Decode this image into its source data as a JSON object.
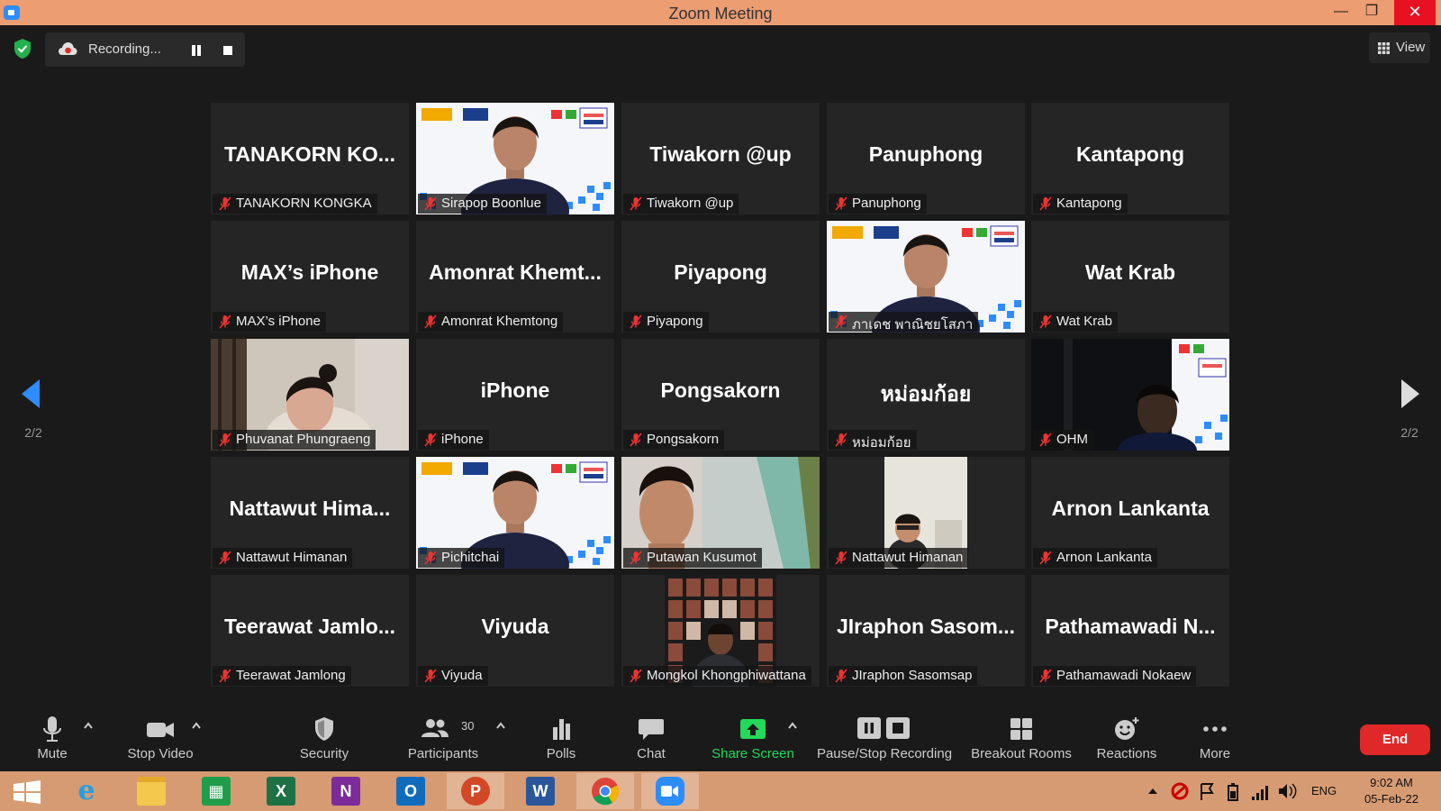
{
  "window": {
    "title": "Zoom Meeting"
  },
  "recording": {
    "label": "Recording..."
  },
  "view_label": "View",
  "pagination": {
    "left": "2/2",
    "right": "2/2"
  },
  "tiles": [
    {
      "big": "TANAKORN  KO...",
      "name": "TANAKORN KONGKA",
      "video": false
    },
    {
      "big": "",
      "name": "Sirapop Boonlue",
      "video": true,
      "scene": "banner"
    },
    {
      "big": "Tiwakorn @up",
      "name": "Tiwakorn @up",
      "video": false
    },
    {
      "big": "Panuphong",
      "name": "Panuphong",
      "video": false
    },
    {
      "big": "Kantapong",
      "name": "Kantapong",
      "video": false
    },
    {
      "big": "MAX’s iPhone",
      "name": "MAX’s iPhone",
      "video": false
    },
    {
      "big": "Amonrat  Khemt...",
      "name": "Amonrat Khemtong",
      "video": false
    },
    {
      "big": "Piyapong",
      "name": "Piyapong",
      "video": false
    },
    {
      "big": "",
      "name": "ภาเดช พาณิชยโสภา",
      "video": true,
      "scene": "banner"
    },
    {
      "big": "Wat Krab",
      "name": "Wat Krab",
      "video": false
    },
    {
      "big": "",
      "name": "Phuvanat Phungraeng",
      "video": true,
      "scene": "room"
    },
    {
      "big": "iPhone",
      "name": "iPhone",
      "video": false
    },
    {
      "big": "Pongsakorn",
      "name": "Pongsakorn",
      "video": false
    },
    {
      "big": "หม่อมก้อย",
      "name": "หม่อมก้อย",
      "video": false
    },
    {
      "big": "",
      "name": "OHM",
      "video": true,
      "scene": "dark-banner"
    },
    {
      "big": "Nattawut  Hima...",
      "name": "Nattawut Himanan",
      "video": false
    },
    {
      "big": "",
      "name": "Pichitchai",
      "video": true,
      "scene": "banner"
    },
    {
      "big": "",
      "name": "Putawan Kusumot",
      "video": true,
      "scene": "green"
    },
    {
      "big": "",
      "name": "Nattawut Himanan",
      "video": true,
      "scene": "portrait"
    },
    {
      "big": "Arnon Lankanta",
      "name": "Arnon Lankanta",
      "video": false
    },
    {
      "big": "Teerawat  Jamlo...",
      "name": "Teerawat Jamlong",
      "video": false
    },
    {
      "big": "Viyuda",
      "name": "Viyuda",
      "video": false
    },
    {
      "big": "",
      "name": "Mongkol Khongphiwattana",
      "video": true,
      "scene": "posters"
    },
    {
      "big": "JIraphon  Sasom...",
      "name": "JIraphon Sasomsap",
      "video": false
    },
    {
      "big": "Pathamawadi  N...",
      "name": "Pathamawadi Nokaew",
      "video": false
    }
  ],
  "toolbar": {
    "mute": "Mute",
    "stop_video": "Stop Video",
    "security": "Security",
    "participants": "Participants",
    "participant_count": "30",
    "polls": "Polls",
    "chat": "Chat",
    "share_screen": "Share Screen",
    "pause_stop_recording": "Pause/Stop Recording",
    "breakout_rooms": "Breakout Rooms",
    "reactions": "Reactions",
    "more": "More",
    "end": "End"
  },
  "taskbar": {
    "apps": [
      "start",
      "internet-explorer",
      "file-explorer",
      "sheets",
      "excel",
      "onenote",
      "outlook",
      "powerpoint",
      "word",
      "chrome",
      "zoom"
    ],
    "language": "ENG",
    "time": "9:02 AM",
    "date": "05-Feb-22"
  },
  "colors": {
    "accent": "#2d8cff",
    "share_green": "#23d959",
    "end_red": "#e02828",
    "title_bar": "#ec9d72"
  }
}
